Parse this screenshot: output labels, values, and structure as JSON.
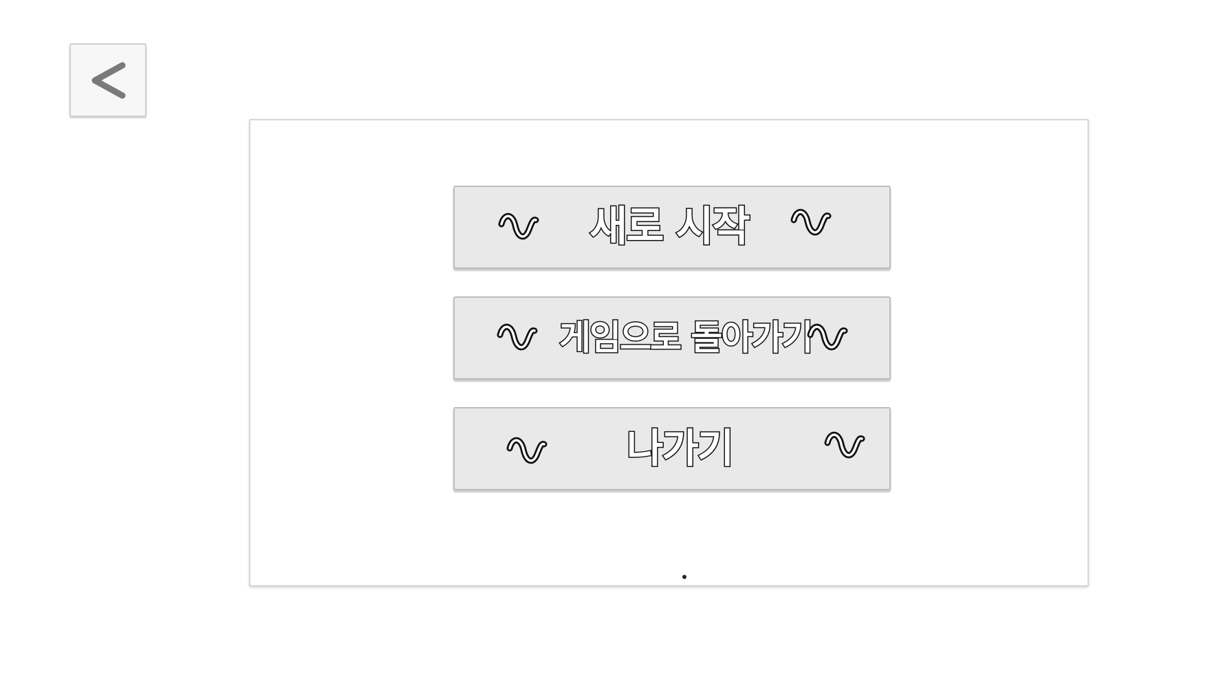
{
  "back_button": {
    "icon": "chevron-left-icon",
    "symbol": "<"
  },
  "menu": {
    "items": [
      {
        "label": "새로 시작",
        "decoration": "~"
      },
      {
        "label": "게임으로 돌아가기",
        "decoration": "~"
      },
      {
        "label": "나가기",
        "decoration": "~"
      }
    ]
  },
  "colors": {
    "background": "#ffffff",
    "panel_border": "#d6d6d6",
    "button_fill": "#e9e9e9",
    "button_border": "#bdbdbd",
    "back_icon": "#7a7a7a",
    "label_fill": "#ffffff",
    "label_outline": "#111111"
  }
}
